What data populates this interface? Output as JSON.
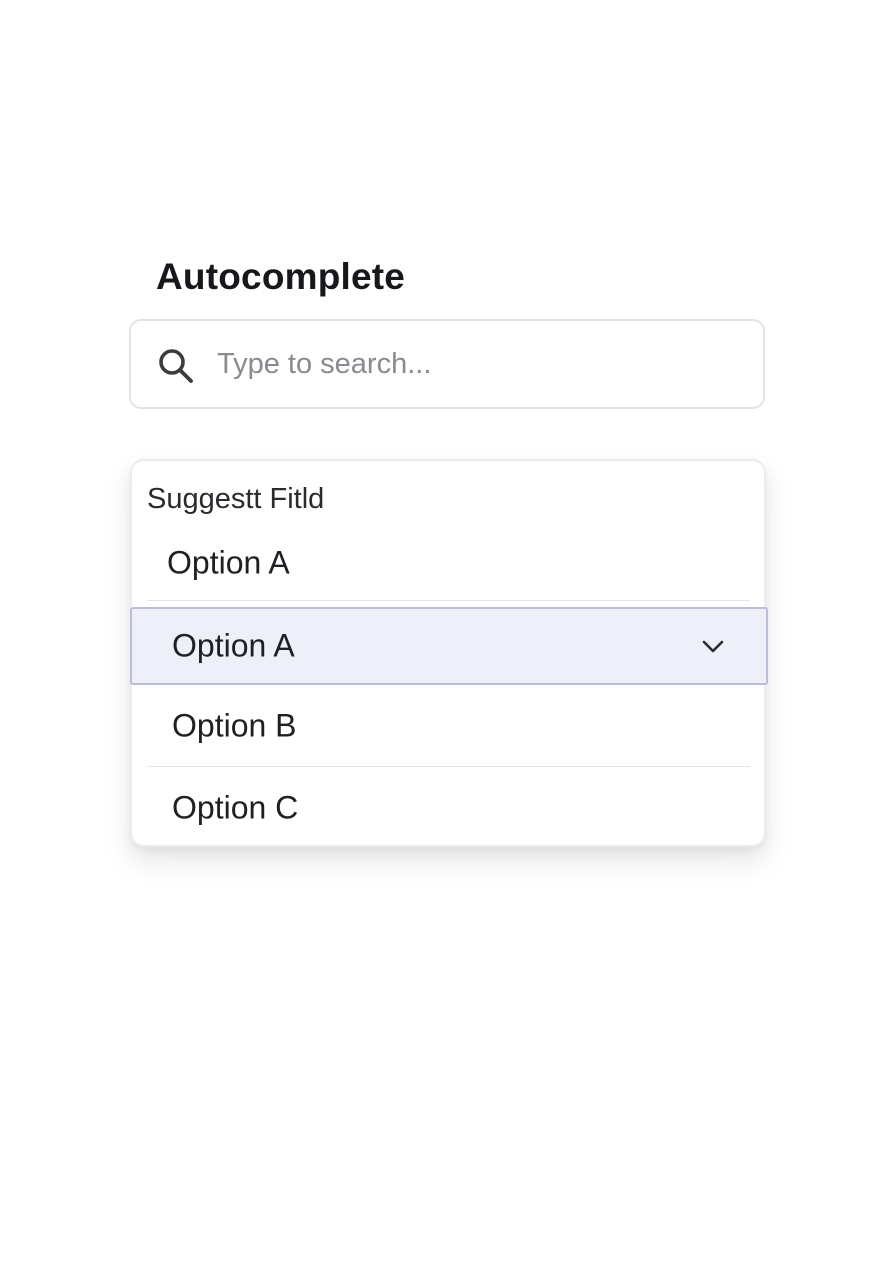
{
  "page": {
    "title": "Autocomplete"
  },
  "search": {
    "icon": "search-icon",
    "placeholder": "Type to search...",
    "value": ""
  },
  "dropdown": {
    "header": "Suggestt Fitld",
    "options": [
      {
        "label": "Option A"
      },
      {
        "label": "Option A",
        "selected": true,
        "icon": "chevron-down-icon"
      },
      {
        "label": "Option B"
      },
      {
        "label": "Option C"
      }
    ]
  },
  "colors": {
    "selected_background": "#edf0f8",
    "selected_border": "#b9bee0",
    "text": "#1c1c21",
    "placeholder": "#8a8a90"
  }
}
